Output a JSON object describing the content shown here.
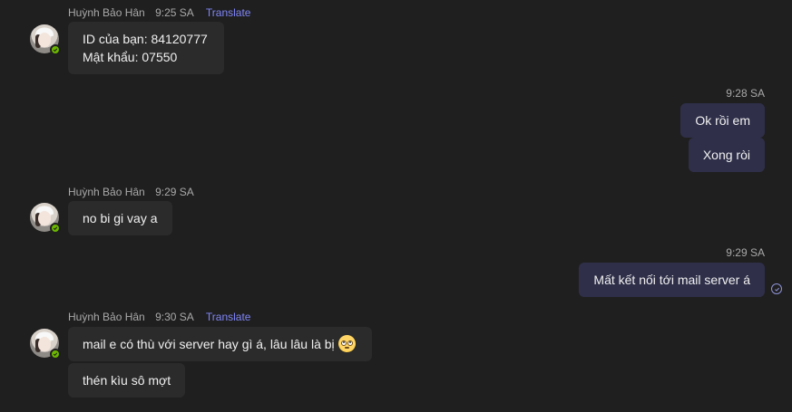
{
  "groups": [
    {
      "sender": "Huỳnh Bảo Hân",
      "time": "9:25 SA",
      "translate": "Translate",
      "messages": [
        "ID của bạn: 84120777",
        "Mật khẩu: 07550"
      ]
    },
    {
      "time": "9:28 SA",
      "messages": [
        "Ok rồi em",
        "Xong ròi"
      ]
    },
    {
      "sender": "Huỳnh Bảo Hân",
      "time": "9:29 SA",
      "messages": [
        "no bi gi vay a"
      ]
    },
    {
      "time": "9:29 SA",
      "messages": [
        "Mất kết nối tới mail server á"
      ]
    },
    {
      "sender": "Huỳnh Bảo Hân",
      "time": "9:30 SA",
      "translate": "Translate",
      "messages": [
        "mail e có thù với server hay gì á, lâu lâu là bị",
        "thén kìu sô mợt"
      ]
    }
  ],
  "icons": {
    "presence": "available-check-icon",
    "read_receipt": "seen-check-icon",
    "emoji": "face-with-rolling-eyes-emoji"
  },
  "colors": {
    "background": "#1f1f1f",
    "incoming_bubble": "#2b2b2b",
    "outgoing_bubble": "#2f2f4a",
    "translate_link": "#7f85f5",
    "presence_green": "#6bb700"
  }
}
